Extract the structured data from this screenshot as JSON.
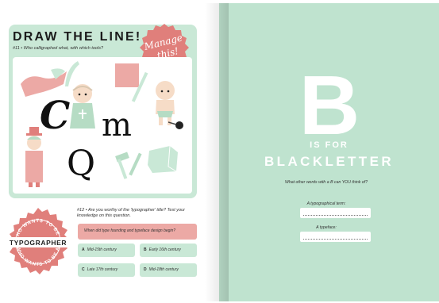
{
  "left_page": {
    "title": "DRAW THE LINE!",
    "question": "#11 • Who calligraphed what, with which tools?",
    "badge_text_line1": "Manage",
    "badge_text_line2": "this!",
    "letters": [
      "C",
      "m",
      "Q"
    ]
  },
  "quiz": {
    "question_intro": "#12 • Are you worthy of the 'typographer' title? Test your knowledge on this question.",
    "question": "When did type founding and typeface design begin?",
    "answers": [
      {
        "key": "A",
        "text": "Mid-15th century"
      },
      {
        "key": "B",
        "text": "Early 16th century"
      },
      {
        "key": "C",
        "text": "Late 17th century"
      },
      {
        "key": "D",
        "text": "Mid-18th century"
      }
    ],
    "badge_top": "WHO WANTS TO BE A",
    "badge_center": "TYPOGRAPHER",
    "badge_bottom": "WHO WANTS TO BE A"
  },
  "right_page": {
    "big_letter": "B",
    "is_for": "IS FOR",
    "word": "BLACKLETTER",
    "prompt": "What other words with a B can YOU think of?",
    "field1_label": "A typographical term:",
    "field2_label": "A typeface:"
  },
  "colors": {
    "mint": "#bfe3cf",
    "mint_light": "#c9e8d6",
    "pink": "#eca9a5",
    "badge_red": "#e07f7b"
  }
}
